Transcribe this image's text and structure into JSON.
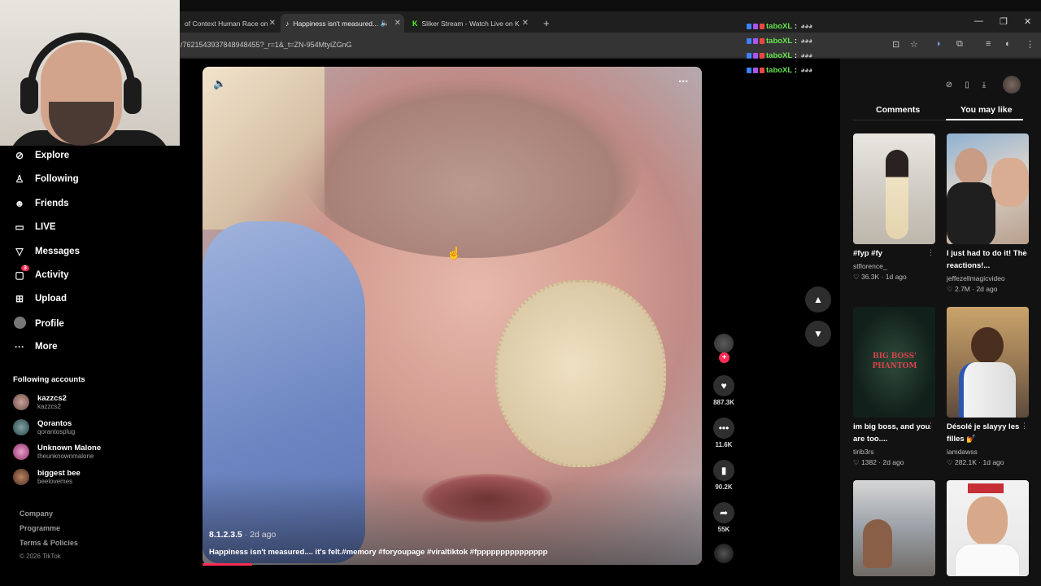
{
  "browser": {
    "tabs": [
      {
        "label": "of Context Human Race on"
      },
      {
        "label": "Happiness isn't measured..."
      },
      {
        "label": "Sliker Stream - Watch Live on K"
      }
    ],
    "new_tab": "+",
    "url": "/7621543937848948455?_r=1&_t=ZN-954MtyiZGnG",
    "window_controls": [
      "—",
      "❐",
      "✕"
    ]
  },
  "chat": {
    "username": "taboXL",
    "colon": ":",
    "emotes": "◕◕◕",
    "lines": 4,
    "badge_colors": [
      "#3b82f6",
      "#a855f7",
      "#ef4444"
    ]
  },
  "sidebar": {
    "nav": [
      {
        "label": "Explore",
        "icon": "compass-icon"
      },
      {
        "label": "Following",
        "icon": "person-plus-icon"
      },
      {
        "label": "Friends",
        "icon": "people-icon"
      },
      {
        "label": "LIVE",
        "icon": "live-icon"
      },
      {
        "label": "Messages",
        "icon": "paper-plane-icon"
      },
      {
        "label": "Activity",
        "icon": "chat-bubble-icon",
        "badge": "3"
      },
      {
        "label": "Upload",
        "icon": "plus-square-icon"
      },
      {
        "label": "Profile",
        "icon": "avatar-icon"
      },
      {
        "label": "More",
        "icon": "ellipsis-icon"
      }
    ],
    "following_title": "Following accounts",
    "accounts": [
      {
        "name": "kazzcs2",
        "handle": "kazzcs2"
      },
      {
        "name": "Qorantos",
        "handle": "qorantosplug"
      },
      {
        "name": "Unknown Malone",
        "handle": "theunknownmalone"
      },
      {
        "name": "biggest bee",
        "handle": "beelovemes"
      }
    ],
    "footer": [
      "Company",
      "Programme",
      "Terms & Policies",
      "© 2026 TikTok"
    ]
  },
  "video": {
    "author": "8.1.2.3.5",
    "separator": " · ",
    "posted": "2d ago",
    "caption": "Happiness isn't measured.... it's felt.#memory #foryoupage #viraltiktok #fppppppppppppppp",
    "progress": 0.1
  },
  "actions": {
    "likes": "887.3K",
    "comments": "11.6K",
    "saves": "90.2K",
    "shares": "55K"
  },
  "panel": {
    "tabs": [
      "Comments",
      "You may like"
    ],
    "active_tab": "You may like",
    "cards": [
      {
        "title": "#fyp #fy",
        "user": "stflorence_",
        "likes": "36.3K",
        "age": "1d ago"
      },
      {
        "title": "I just had to do it! The reactions!...",
        "user": "jeffezellmagicvideo",
        "likes": "2.7M",
        "age": "2d ago"
      },
      {
        "title": "im big boss, and you are too....",
        "user": "tirib3rs",
        "likes": "1382",
        "age": "2d ago"
      },
      {
        "title": "Désolé je slayyy les filles 💅",
        "user": "iamdawss",
        "likes": "282.1K",
        "age": "1d ago"
      },
      {
        "title": "",
        "user": "",
        "likes": "",
        "age": ""
      },
      {
        "title": "",
        "user": "",
        "likes": "",
        "age": ""
      }
    ],
    "thumb3_text": "BIG BOSS' PHANTOM"
  },
  "colors": {
    "accent": "#fe2c55",
    "chat_green": "#64e34c",
    "background": "#000000",
    "panel": "#121212"
  }
}
